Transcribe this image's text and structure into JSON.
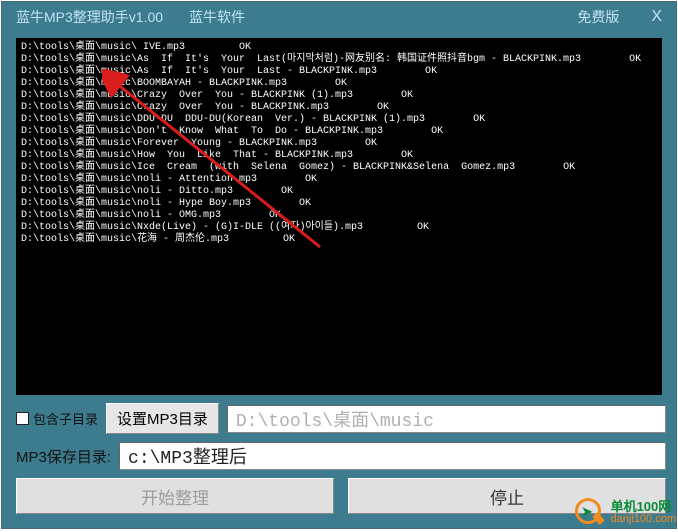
{
  "titlebar": {
    "app_title": "蓝牛MP3整理助手v1.00",
    "brand": "蓝牛软件",
    "badge": "免费版",
    "close": "X"
  },
  "log_lines": [
    "D:\\tools\\桌面\\music\\ IVE.mp3         OK",
    "D:\\tools\\桌面\\music\\As  If  It's  Your  Last(마지막처럼)-网友别名: 韩国证件照抖音bgm - BLACKPINK.mp3        OK",
    "D:\\tools\\桌面\\music\\As  If  It's  Your  Last - BLACKPINK.mp3        OK",
    "D:\\tools\\桌面\\music\\BOOMBAYAH - BLACKPINK.mp3        OK",
    "D:\\tools\\桌面\\music\\Crazy  Over  You - BLACKPINK (1).mp3        OK",
    "D:\\tools\\桌面\\music\\Crazy  Over  You - BLACKPINK.mp3        OK",
    "D:\\tools\\桌面\\music\\DDU-DU  DDU-DU(Korean  Ver.) - BLACKPINK (1).mp3        OK",
    "D:\\tools\\桌面\\music\\Don't  Know  What  To  Do - BLACKPINK.mp3        OK",
    "D:\\tools\\桌面\\music\\Forever  Young - BLACKPINK.mp3        OK",
    "D:\\tools\\桌面\\music\\How  You  Like  That - BLACKPINK.mp3        OK",
    "D:\\tools\\桌面\\music\\Ice  Cream  (with  Selena  Gomez) - BLACKPINK&Selena  Gomez.mp3        OK",
    "D:\\tools\\桌面\\music\\noli - Attention.mp3        OK",
    "D:\\tools\\桌面\\music\\noli - Ditto.mp3        OK",
    "D:\\tools\\桌面\\music\\noli - Hype Boy.mp3        OK",
    "D:\\tools\\桌面\\music\\noli - OMG.mp3        OK",
    "D:\\tools\\桌面\\music\\Nxde(Live) - (G)I-DLE ((여자)아이들).mp3         OK",
    "D:\\tools\\桌面\\music\\花海 - 周杰伦.mp3         OK"
  ],
  "row1": {
    "checkbox_label": "包含子目录",
    "set_dir_btn": "设置MP3目录",
    "dir_value": "D:\\tools\\桌面\\music"
  },
  "row2": {
    "save_label": "MP3保存目录:",
    "save_value": "c:\\MP3整理后"
  },
  "row3": {
    "start": "开始整理",
    "stop": "停止"
  },
  "watermark": {
    "cn": "单机100网",
    "en": "danji100.com"
  }
}
